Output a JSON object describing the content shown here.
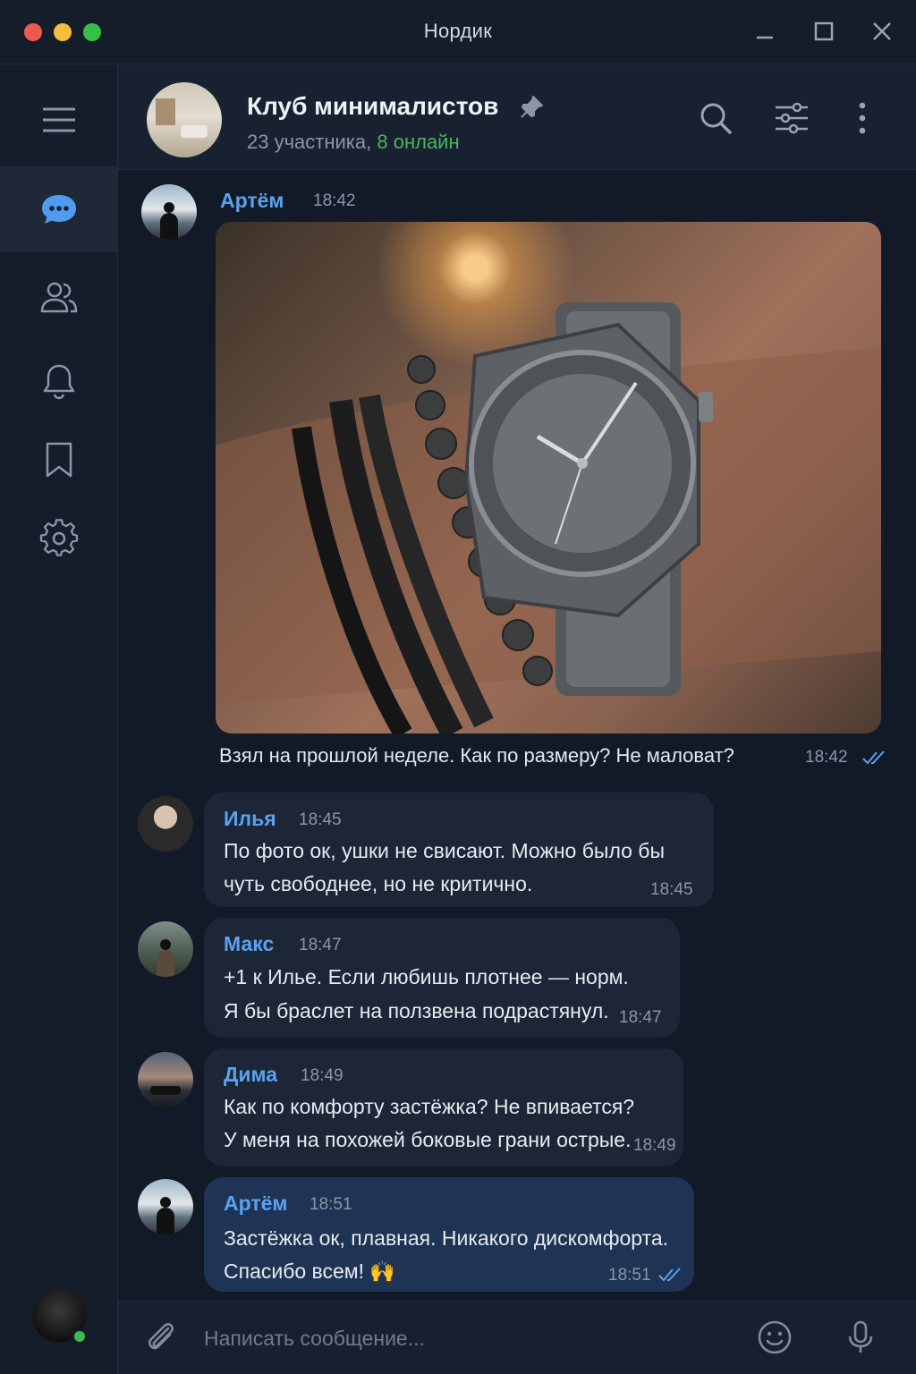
{
  "window": {
    "title": "Нордик"
  },
  "sidebar": {
    "items": [
      {
        "name": "menu",
        "icon": "menu-icon"
      },
      {
        "name": "chats",
        "icon": "chat-bubble-icon",
        "active": true
      },
      {
        "name": "contacts",
        "icon": "people-icon"
      },
      {
        "name": "notifications",
        "icon": "bell-icon"
      },
      {
        "name": "saved",
        "icon": "bookmark-icon"
      },
      {
        "name": "settings",
        "icon": "gear-icon"
      }
    ],
    "profile": {
      "status": "online"
    }
  },
  "header": {
    "title": "Клуб минималистов",
    "members": "23 участника, ",
    "online": "8 онлайн",
    "pinned": true,
    "actions": [
      "search-icon",
      "filter-icon",
      "more-icon"
    ]
  },
  "messages": [
    {
      "sender": "Артём",
      "time": "18:42",
      "has_photo": true,
      "caption": "Взял на прошлой неделе. Как по размеру? Не маловат?",
      "stamp": "18:42",
      "read": true
    },
    {
      "sender": "Илья",
      "time": "18:45",
      "lines": [
        "По фото ок, ушки не свисают. Можно было бы",
        "чуть свободнее, но не критично."
      ],
      "stamp": "18:45"
    },
    {
      "sender": "Макс",
      "time": "18:47",
      "lines": [
        "+1 к Илье. Если любишь плотнее — норм.",
        "Я бы браслет на ползвена подрастянул."
      ],
      "stamp": "18:47"
    },
    {
      "sender": "Дима",
      "time": "18:49",
      "lines": [
        "Как по комфорту застёжка? Не впивается?",
        "У меня на похожей боковые грани острые."
      ],
      "stamp": "18:49"
    },
    {
      "sender": "Артём",
      "time": "18:51",
      "lines": [
        "Застёжка ок, плавная. Никакого дискомфорта.",
        "Спасибо всем! 🙌"
      ],
      "stamp": "18:51",
      "read": true,
      "own": true
    }
  ],
  "composer": {
    "placeholder": "Написать сообщение..."
  },
  "colors": {
    "accent": "#5aa2ef",
    "online": "#4cb45e",
    "background": "#121a27"
  }
}
